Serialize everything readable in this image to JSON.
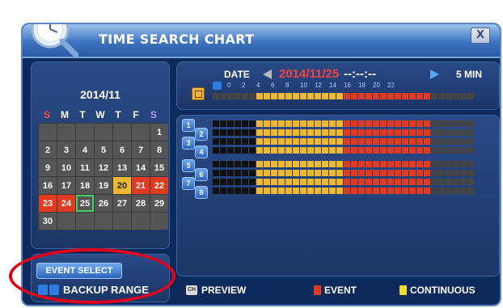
{
  "window": {
    "title": "TIME SEARCH CHART",
    "close_label": "X"
  },
  "calendar": {
    "month_label": "2014/11",
    "weekdays": [
      "S",
      "M",
      "T",
      "W",
      "T",
      "F",
      "S"
    ],
    "cells": [
      "",
      "",
      "",
      "",
      "",
      "",
      "1",
      "2",
      "3",
      "4",
      "5",
      "6",
      "7",
      "8",
      "9",
      "10",
      "11",
      "12",
      "13",
      "14",
      "15",
      "16",
      "17",
      "18",
      "19",
      "20",
      "21",
      "22",
      "23",
      "24",
      "25",
      "26",
      "27",
      "28",
      "29",
      "30",
      "",
      "",
      "",
      "",
      "",
      ""
    ],
    "event_days": [
      "21",
      "22",
      "23",
      "24"
    ],
    "continuous_days": [
      "20"
    ],
    "selected_day": "25"
  },
  "controls": {
    "event_select_label": "EVENT SELECT",
    "backup_range_label": "BACKUP RANGE"
  },
  "date_bar": {
    "date_label": "DATE",
    "date_value": "2014/11/25",
    "time_value": "--:--:--",
    "interval_label": "5 MIN",
    "hour_ticks": [
      "0",
      "2",
      "4",
      "6",
      "8",
      "10",
      "12",
      "14",
      "16",
      "18",
      "20",
      "22"
    ]
  },
  "timeline": {
    "segments_per_row": 36,
    "overview_pattern": {
      "black": [
        0,
        6
      ],
      "yellow": [
        6,
        18
      ],
      "red": [
        18,
        30
      ],
      "dark": [
        30,
        36
      ]
    },
    "rows": [
      {
        "channel": "1"
      },
      {
        "channel": "2"
      },
      {
        "channel": "3"
      },
      {
        "channel": "4"
      },
      {
        "channel": "5"
      },
      {
        "channel": "6"
      },
      {
        "channel": "7"
      },
      {
        "channel": "8"
      }
    ]
  },
  "legend": {
    "preview_label": "PREVIEW",
    "event_label": "EVENT",
    "continuous_label": "CONTINUOUS",
    "ch_key": "CH"
  },
  "colors": {
    "event": "#e23a1f",
    "continuous": "#f0b82e",
    "empty": "#444444",
    "background": "#0e2a5c"
  }
}
